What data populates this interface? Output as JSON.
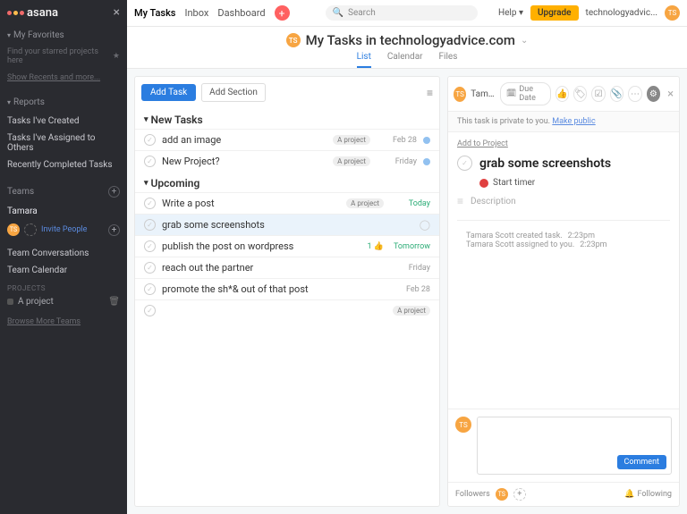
{
  "brand": "asana",
  "sidebar": {
    "favorites_h": "My Favorites",
    "favorites_hint": "Find your starred projects here",
    "show_recents": "Show Recents and more...",
    "reports_h": "Reports",
    "reports": [
      "Tasks I've Created",
      "Tasks I've Assigned to Others",
      "Recently Completed Tasks"
    ],
    "teams_h": "Teams",
    "team_name": "Tamara",
    "team_initials": "TS",
    "invite": "Invite People",
    "team_items": [
      "Team Conversations",
      "Team Calendar"
    ],
    "projects_h": "PROJECTS",
    "project": "A project",
    "browse": "Browse More Teams"
  },
  "topnav": {
    "items": [
      "My Tasks",
      "Inbox",
      "Dashboard"
    ],
    "search_ph": "Search",
    "help": "Help",
    "upgrade": "Upgrade",
    "account": "technologyadvic...",
    "initials": "TS"
  },
  "page": {
    "initials": "TS",
    "title": "My Tasks in technologyadvice.com",
    "tabs": [
      "List",
      "Calendar",
      "Files"
    ]
  },
  "tl": {
    "add_task": "Add Task",
    "add_section": "Add Section",
    "sections": [
      {
        "name": "New Tasks",
        "tasks": [
          {
            "title": "add an image",
            "tag": "A project",
            "date": "Feb 28",
            "dot": true
          },
          {
            "title": "New Project?",
            "tag": "A project",
            "date": "Friday",
            "dot": true
          }
        ]
      },
      {
        "name": "Upcoming",
        "tasks": [
          {
            "title": "Write a post",
            "tag": "A project",
            "date": "Today",
            "today": true
          },
          {
            "title": "grab some screenshots",
            "selected": true
          },
          {
            "title": "publish the post on wordpress",
            "date": "Tomorrow",
            "tomorrow": true,
            "like": "1"
          },
          {
            "title": "reach out the partner",
            "date": "Friday"
          },
          {
            "title": "promote the sh*& out of that post",
            "date": "Feb 28"
          },
          {
            "title": "",
            "tag": "A project",
            "empty": true
          }
        ]
      }
    ]
  },
  "detail": {
    "assignee": "Tama...",
    "initials": "TS",
    "due": "Due Date",
    "private": "This task is private to you.",
    "make_public": "Make public",
    "add_project": "Add to Project",
    "title": "grab some screenshots",
    "timer": "Start timer",
    "desc_ph": "Description",
    "log": [
      {
        "text": "Tamara Scott created task.",
        "time": "2:23pm"
      },
      {
        "text": "Tamara Scott assigned to you.",
        "time": "2:23pm"
      }
    ],
    "comment_btn": "Comment",
    "followers": "Followers",
    "following": "Following"
  }
}
